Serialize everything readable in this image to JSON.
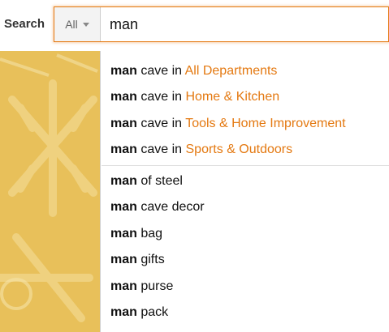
{
  "search": {
    "label": "Search",
    "scope": "All",
    "query": "man"
  },
  "suggestions": {
    "department": [
      {
        "bold": "man",
        "text": " cave in ",
        "dept": "All Departments"
      },
      {
        "bold": "man",
        "text": " cave in ",
        "dept": "Home & Kitchen"
      },
      {
        "bold": "man",
        "text": " cave in ",
        "dept": "Tools & Home Improvement"
      },
      {
        "bold": "man",
        "text": " cave in ",
        "dept": "Sports & Outdoors"
      }
    ],
    "general": [
      {
        "bold": "man",
        "text": " of steel"
      },
      {
        "bold": "man",
        "text": " cave decor"
      },
      {
        "bold": "man",
        "text": " bag"
      },
      {
        "bold": "man",
        "text": " gifts"
      },
      {
        "bold": "man",
        "text": " purse"
      },
      {
        "bold": "man",
        "text": " pack"
      }
    ]
  },
  "colors": {
    "accent": "#e47911",
    "background_panel": "#e8c05a"
  }
}
